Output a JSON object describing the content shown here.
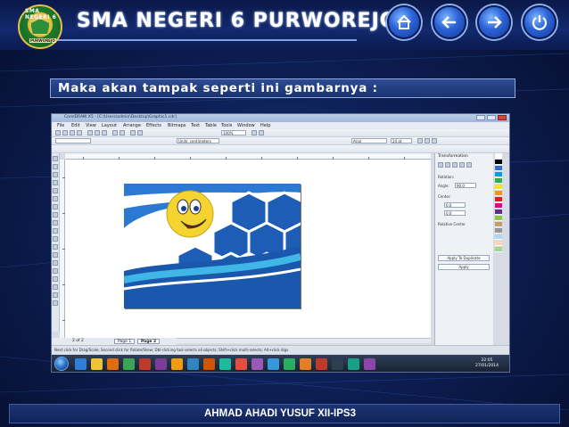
{
  "header": {
    "title": "SMA NEGERI 6 PURWOREJO",
    "logo": {
      "arc_text": "SMA NEGERI 6",
      "tag_text": "PURWOREJO"
    },
    "nav_buttons": [
      {
        "name": "home-button",
        "icon": "home-icon"
      },
      {
        "name": "back-button",
        "icon": "arrow-left-icon"
      },
      {
        "name": "forward-button",
        "icon": "arrow-right-icon"
      },
      {
        "name": "power-button",
        "icon": "power-icon"
      }
    ]
  },
  "subtitle": "Maka akan tampak seperti ini gambarnya :",
  "screenshot": {
    "titlebar": "CorelDRAW X5 - [C:\\Users\\admin\\Desktop\\Graphic1.cdr]",
    "menu": [
      "File",
      "Edit",
      "View",
      "Layout",
      "Arrange",
      "Effects",
      "Bitmaps",
      "Text",
      "Table",
      "Tools",
      "Window",
      "Help"
    ],
    "zoom": "100%",
    "units": "Units: centimeters",
    "font_name": "Arial",
    "font_size": "24 pt",
    "page_counter": "2 of 2",
    "pages": [
      "Page 1",
      "Page 2"
    ],
    "status": "Next click for Drag/Scale; Second click for Rotate/Skew; Dbl-clicking tool selects all objects; Shift+click multi-selects; Alt+click digs",
    "docker": {
      "title": "Transformation",
      "rotation_label": "Rotation:",
      "angle_label": "Angle:",
      "angle_value": "90.0",
      "center_label": "Center:",
      "h_value": "0.0",
      "v_value": "0.0",
      "relative_center": "Relative Center",
      "apply_duplicate": "Apply To Duplicate",
      "apply": "Apply"
    },
    "clock_time": "22:05",
    "clock_date": "27/01/2014"
  },
  "footer": "AHMAD AHADI YUSUF XII-IPS3",
  "colors": {
    "accent": "#1f5fb8",
    "header_bg": "#0a1848",
    "smiley": "#f5d431"
  }
}
